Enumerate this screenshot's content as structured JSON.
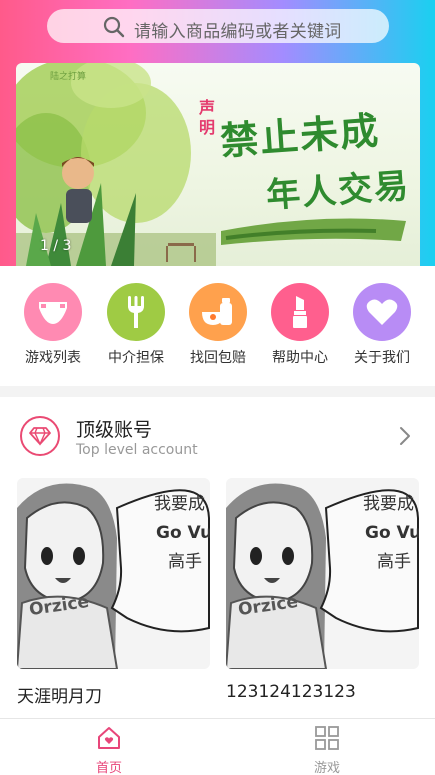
{
  "search": {
    "placeholder": "请输入商品编码或者关键词"
  },
  "banner": {
    "counter": "1 / 3",
    "vertical_text": "声明",
    "headline_line1": "禁止未成",
    "headline_line2": "年人交易",
    "logo_text": "陆之打算"
  },
  "nav": {
    "items": [
      {
        "label": "游戏列表",
        "icon": "diaper-icon",
        "color": "#ff8ab2"
      },
      {
        "label": "中介担保",
        "icon": "fork-icon",
        "color": "#9fcb44"
      },
      {
        "label": "找回包赔",
        "icon": "bottle-bowl-icon",
        "color": "#ffa14d"
      },
      {
        "label": "帮助中心",
        "icon": "lipstick-icon",
        "color": "#ff5f8e"
      },
      {
        "label": "关于我们",
        "icon": "heart-icon",
        "color": "#b88cf5"
      }
    ]
  },
  "section": {
    "title": "顶级账号",
    "subtitle": "Top level account",
    "icon": "diamond-icon"
  },
  "cards": [
    {
      "name": "天涯明月刀",
      "meme_lines": [
        "我要成",
        "Go Vu",
        "高手"
      ],
      "shirt_text": "Orzice"
    },
    {
      "name": "123124123123",
      "meme_lines": [
        "我要成",
        "Go Vu",
        "高手"
      ],
      "shirt_text": "Orzice"
    }
  ],
  "tabbar": {
    "tabs": [
      {
        "label": "首页",
        "icon": "home-icon",
        "active": true
      },
      {
        "label": "游戏",
        "icon": "grid-icon",
        "active": false
      }
    ]
  },
  "colors": {
    "accent": "#e8467a",
    "inactive": "#999999"
  }
}
